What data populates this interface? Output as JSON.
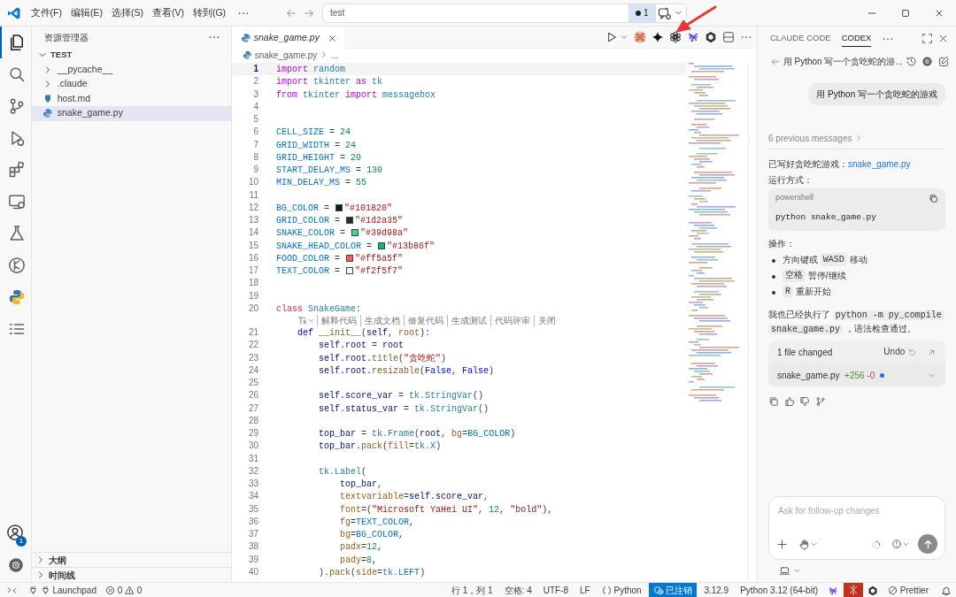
{
  "title_bar": {
    "menus": [
      "文件(F)",
      "编辑(E)",
      "选择(S)",
      "查看(V)",
      "转到(G)"
    ],
    "search": {
      "value": "test"
    },
    "changes_count": "1"
  },
  "activity_bar": {
    "items": [
      {
        "selected": true
      },
      {
        "selected": false
      },
      {
        "selected": false
      },
      {
        "selected": false
      },
      {
        "selected": false
      },
      {
        "selected": false
      },
      {
        "selected": false
      },
      {
        "selected": false
      },
      {
        "selected": false
      },
      {
        "selected": false
      }
    ],
    "account_badge": "1"
  },
  "explorer": {
    "title": "资源管理器",
    "root": {
      "label": "TEST",
      "expanded": true,
      "children": [
        {
          "label": "__pycache__",
          "kind": "folder",
          "expanded": false,
          "selected": false
        },
        {
          "label": ".claude",
          "kind": "folder",
          "expanded": false,
          "selected": false
        },
        {
          "label": "host.md",
          "kind": "markdown",
          "selected": false
        },
        {
          "label": "snake_game.py",
          "kind": "python",
          "selected": true
        }
      ]
    },
    "sections": [
      {
        "label": "大纲",
        "expanded": false
      },
      {
        "label": "时间线",
        "expanded": false
      }
    ]
  },
  "editor": {
    "tabs": [
      {
        "label": "snake_game.py",
        "selected": true,
        "preview": true
      }
    ],
    "breadcrumb": [
      "snake_game.py",
      "..."
    ],
    "lines": [
      {
        "number": "1",
        "current": true,
        "tokens": [
          {
            "text": "import",
            "kind": "keyword"
          },
          {
            "text": " random",
            "kind": "module"
          }
        ]
      },
      {
        "number": "2",
        "current": false,
        "tokens": [
          {
            "text": "import",
            "kind": "keyword"
          },
          {
            "text": " tkinter ",
            "kind": "module"
          },
          {
            "text": "as",
            "kind": "keyword"
          },
          {
            "text": " tk",
            "kind": "module"
          }
        ]
      },
      {
        "number": "3",
        "current": false,
        "tokens": [
          {
            "text": "from",
            "kind": "keyword"
          },
          {
            "text": " tkinter ",
            "kind": "module"
          },
          {
            "text": "import",
            "kind": "keyword"
          },
          {
            "text": " messagebox",
            "kind": "module"
          }
        ]
      },
      {
        "number": "4",
        "current": false
      },
      {
        "number": "5",
        "current": false
      },
      {
        "number": "6",
        "current": false,
        "tokens": [
          {
            "text": "CELL_SIZE",
            "kind": "constant"
          },
          {
            "text": " = ",
            "kind": "punct"
          },
          {
            "text": "24",
            "kind": "number"
          }
        ]
      },
      {
        "number": "7",
        "current": false,
        "tokens": [
          {
            "text": "GRID_WIDTH",
            "kind": "constant"
          },
          {
            "text": " = ",
            "kind": "punct"
          },
          {
            "text": "24",
            "kind": "number"
          }
        ]
      },
      {
        "number": "8",
        "current": false,
        "tokens": [
          {
            "text": "GRID_HEIGHT",
            "kind": "constant"
          },
          {
            "text": " = ",
            "kind": "punct"
          },
          {
            "text": "20",
            "kind": "number"
          }
        ]
      },
      {
        "number": "9",
        "current": false,
        "tokens": [
          {
            "text": "START_DELAY_MS",
            "kind": "constant"
          },
          {
            "text": " = ",
            "kind": "punct"
          },
          {
            "text": "130",
            "kind": "number"
          }
        ]
      },
      {
        "number": "10",
        "current": false,
        "tokens": [
          {
            "text": "MIN_DELAY_MS",
            "kind": "constant"
          },
          {
            "text": " = ",
            "kind": "punct"
          },
          {
            "text": "55",
            "kind": "number"
          }
        ]
      },
      {
        "number": "11",
        "current": false
      },
      {
        "number": "12",
        "current": false,
        "tokens": [
          {
            "text": "BG_COLOR",
            "kind": "constant"
          },
          {
            "text": " = ",
            "kind": "punct"
          },
          {
            "kind": "swatch",
            "color": "#101820"
          },
          {
            "text": "\"#101820\"",
            "kind": "string"
          }
        ]
      },
      {
        "number": "13",
        "current": false,
        "tokens": [
          {
            "text": "GRID_COLOR",
            "kind": "constant"
          },
          {
            "text": " = ",
            "kind": "punct"
          },
          {
            "kind": "swatch",
            "color": "#1d2a35"
          },
          {
            "text": "\"#1d2a35\"",
            "kind": "string"
          }
        ]
      },
      {
        "number": "14",
        "current": false,
        "tokens": [
          {
            "text": "SNAKE_COLOR",
            "kind": "constant"
          },
          {
            "text": " = ",
            "kind": "punct"
          },
          {
            "kind": "swatch",
            "color": "#39d98a"
          },
          {
            "text": "\"#39d98a\"",
            "kind": "string"
          }
        ]
      },
      {
        "number": "15",
        "current": false,
        "tokens": [
          {
            "text": "SNAKE_HEAD_COLOR",
            "kind": "constant"
          },
          {
            "text": " = ",
            "kind": "punct"
          },
          {
            "kind": "swatch",
            "color": "#13b86f"
          },
          {
            "text": "\"#13b86f\"",
            "kind": "string"
          }
        ]
      },
      {
        "number": "16",
        "current": false,
        "tokens": [
          {
            "text": "FOOD_COLOR",
            "kind": "constant"
          },
          {
            "text": " = ",
            "kind": "punct"
          },
          {
            "kind": "swatch",
            "color": "#ff5a5f"
          },
          {
            "text": "\"#ff5a5f\"",
            "kind": "string"
          }
        ]
      },
      {
        "number": "17",
        "current": false,
        "tokens": [
          {
            "text": "TEXT_COLOR",
            "kind": "constant"
          },
          {
            "text": " = ",
            "kind": "punct"
          },
          {
            "kind": "swatch",
            "color": "#f2f5f7"
          },
          {
            "text": "\"#f2f5f7\"",
            "kind": "string"
          }
        ]
      },
      {
        "number": "18",
        "current": false
      },
      {
        "number": "19",
        "current": false
      },
      {
        "number": "20",
        "current": false,
        "tokens": [
          {
            "text": "class",
            "kind": "class"
          },
          {
            "text": " SnakeGame",
            "kind": "module"
          },
          {
            "text": ":",
            "kind": "punct"
          }
        ],
        "codelens": {
          "items": [
            "解释代码",
            "生成文档",
            "修复代码",
            "生成测试",
            "代码评审",
            "关闭"
          ]
        }
      },
      {
        "number": "21",
        "current": false,
        "tokens": [
          {
            "text": "    def",
            "kind": "def"
          },
          {
            "text": " __init__",
            "kind": "function"
          },
          {
            "text": "(",
            "kind": "punct"
          },
          {
            "text": "self",
            "kind": "variable"
          },
          {
            "text": ", ",
            "kind": "punct"
          },
          {
            "text": "root",
            "kind": "param"
          },
          {
            "text": "):",
            "kind": "punct"
          }
        ]
      },
      {
        "number": "22",
        "current": false,
        "tokens": [
          {
            "text": "        self.root",
            "kind": "variable"
          },
          {
            "text": " = ",
            "kind": "punct"
          },
          {
            "text": "root",
            "kind": "variable"
          }
        ]
      },
      {
        "number": "23",
        "current": false,
        "tokens": [
          {
            "text": "        self.root.",
            "kind": "variable"
          },
          {
            "text": "title",
            "kind": "function"
          },
          {
            "text": "(",
            "kind": "punct"
          },
          {
            "text": "\"贪吃蛇\"",
            "kind": "string"
          },
          {
            "text": ")",
            "kind": "punct"
          }
        ]
      },
      {
        "number": "24",
        "current": false,
        "tokens": [
          {
            "text": "        self.root.",
            "kind": "variable"
          },
          {
            "text": "resizable",
            "kind": "function"
          },
          {
            "text": "(",
            "kind": "punct"
          },
          {
            "text": "False",
            "kind": "bool"
          },
          {
            "text": ", ",
            "kind": "punct"
          },
          {
            "text": "False",
            "kind": "bool"
          },
          {
            "text": ")",
            "kind": "punct"
          }
        ]
      },
      {
        "number": "25",
        "current": false
      },
      {
        "number": "26",
        "current": false,
        "tokens": [
          {
            "text": "        self.score_var",
            "kind": "variable"
          },
          {
            "text": " = ",
            "kind": "punct"
          },
          {
            "text": "tk.StringVar",
            "kind": "module"
          },
          {
            "text": "()",
            "kind": "punct"
          }
        ]
      },
      {
        "number": "27",
        "current": false,
        "tokens": [
          {
            "text": "        self.status_var",
            "kind": "variable"
          },
          {
            "text": " = ",
            "kind": "punct"
          },
          {
            "text": "tk.StringVar",
            "kind": "module"
          },
          {
            "text": "()",
            "kind": "punct"
          }
        ]
      },
      {
        "number": "28",
        "current": false
      },
      {
        "number": "29",
        "current": false,
        "tokens": [
          {
            "text": "        top_bar",
            "kind": "variable"
          },
          {
            "text": " = ",
            "kind": "punct"
          },
          {
            "text": "tk.Frame",
            "kind": "module"
          },
          {
            "text": "(",
            "kind": "punct"
          },
          {
            "text": "root",
            "kind": "variable"
          },
          {
            "text": ", ",
            "kind": "punct"
          },
          {
            "text": "bg",
            "kind": "param"
          },
          {
            "text": "=",
            "kind": "punct"
          },
          {
            "text": "BG_COLOR",
            "kind": "constant"
          },
          {
            "text": ")",
            "kind": "punct"
          }
        ]
      },
      {
        "number": "30",
        "current": false,
        "tokens": [
          {
            "text": "        top_bar.",
            "kind": "variable"
          },
          {
            "text": "pack",
            "kind": "function"
          },
          {
            "text": "(",
            "kind": "punct"
          },
          {
            "text": "fill",
            "kind": "param"
          },
          {
            "text": "=",
            "kind": "punct"
          },
          {
            "text": "tk.",
            "kind": "module"
          },
          {
            "text": "X",
            "kind": "constant"
          },
          {
            "text": ")",
            "kind": "punct"
          }
        ]
      },
      {
        "number": "31",
        "current": false
      },
      {
        "number": "32",
        "current": false,
        "tokens": [
          {
            "text": "        tk.Label",
            "kind": "module"
          },
          {
            "text": "(",
            "kind": "punct"
          }
        ]
      },
      {
        "number": "33",
        "current": false,
        "tokens": [
          {
            "text": "            top_bar",
            "kind": "variable"
          },
          {
            "text": ",",
            "kind": "punct"
          }
        ]
      },
      {
        "number": "34",
        "current": false,
        "tokens": [
          {
            "text": "            textvariable",
            "kind": "param"
          },
          {
            "text": "=",
            "kind": "punct"
          },
          {
            "text": "self.score_var",
            "kind": "variable"
          },
          {
            "text": ",",
            "kind": "punct"
          }
        ]
      },
      {
        "number": "35",
        "current": false,
        "tokens": [
          {
            "text": "            font",
            "kind": "param"
          },
          {
            "text": "=(",
            "kind": "punct"
          },
          {
            "text": "\"Microsoft YaHei UI\"",
            "kind": "string"
          },
          {
            "text": ", ",
            "kind": "punct"
          },
          {
            "text": "12",
            "kind": "number"
          },
          {
            "text": ", ",
            "kind": "punct"
          },
          {
            "text": "\"bold\"",
            "kind": "string"
          },
          {
            "text": "),",
            "kind": "punct"
          }
        ]
      },
      {
        "number": "36",
        "current": false,
        "tokens": [
          {
            "text": "            fg",
            "kind": "param"
          },
          {
            "text": "=",
            "kind": "punct"
          },
          {
            "text": "TEXT_COLOR",
            "kind": "constant"
          },
          {
            "text": ",",
            "kind": "punct"
          }
        ]
      },
      {
        "number": "37",
        "current": false,
        "tokens": [
          {
            "text": "            bg",
            "kind": "param"
          },
          {
            "text": "=",
            "kind": "punct"
          },
          {
            "text": "BG_COLOR",
            "kind": "constant"
          },
          {
            "text": ",",
            "kind": "punct"
          }
        ]
      },
      {
        "number": "38",
        "current": false,
        "tokens": [
          {
            "text": "            padx",
            "kind": "param"
          },
          {
            "text": "=",
            "kind": "punct"
          },
          {
            "text": "12",
            "kind": "number"
          },
          {
            "text": ",",
            "kind": "punct"
          }
        ]
      },
      {
        "number": "39",
        "current": false,
        "tokens": [
          {
            "text": "            pady",
            "kind": "param"
          },
          {
            "text": "=",
            "kind": "punct"
          },
          {
            "text": "8",
            "kind": "number"
          },
          {
            "text": ",",
            "kind": "punct"
          }
        ]
      },
      {
        "number": "40",
        "current": false,
        "tokens": [
          {
            "text": "        ).",
            "kind": "punct"
          },
          {
            "text": "pack",
            "kind": "function"
          },
          {
            "text": "(",
            "kind": "punct"
          },
          {
            "text": "side",
            "kind": "param"
          },
          {
            "text": "=",
            "kind": "punct"
          },
          {
            "text": "tk.",
            "kind": "module"
          },
          {
            "text": "LEFT",
            "kind": "constant"
          },
          {
            "text": ")",
            "kind": "punct"
          }
        ]
      }
    ]
  },
  "chat_panel": {
    "tabs": [
      {
        "label": "CLAUDE CODE",
        "selected": false
      },
      {
        "label": "CODEX",
        "selected": true
      }
    ],
    "thread_title": "用 Python 写一个贪吃蛇的游...",
    "user_message": "用 Python 写一个贪吃蛇的游戏",
    "previous_messages": "6 previous messages",
    "reply": {
      "intro": "已写好贪吃蛇游戏：",
      "intro_link": "snake_game.py",
      "run_label": "运行方式：",
      "code_block": {
        "language": "powershell",
        "code": "python snake_game.py"
      },
      "controls_label": "操作：",
      "bullets": [
        [
          {
            "kind": "text",
            "text": "方向键或"
          },
          {
            "kind": "code",
            "text": "WASD"
          },
          {
            "kind": "text",
            "text": "移动"
          }
        ],
        [
          {
            "kind": "code",
            "text": "空格"
          },
          {
            "kind": "text",
            "text": "暂停/继续"
          }
        ],
        [
          {
            "kind": "code",
            "text": "R"
          },
          {
            "kind": "text",
            "text": "重新开始"
          }
        ]
      ],
      "closing": [
        {
          "kind": "text",
          "text": "我也已经执行了"
        },
        {
          "kind": "code",
          "text": "python -m py_compile"
        },
        {
          "kind": "code",
          "text": "snake_game.py"
        },
        {
          "kind": "text",
          "text": "，语法检查通过。"
        }
      ]
    },
    "changes": {
      "summary": "1 file changed",
      "undo": "Undo",
      "files": [
        {
          "name": "snake_game.py",
          "added": "+256",
          "removed": "-0",
          "pending": true
        }
      ]
    },
    "composer": {
      "placeholder": "Ask for follow-up changes"
    }
  },
  "status_bar": {
    "launchpad": "Launchpad",
    "errors": "0",
    "warnings": "0",
    "position": "行 1，列 1",
    "indent": "空格: 4",
    "encoding": "UTF-8",
    "eol": "LF",
    "language": "Python",
    "account": "已注销",
    "python_version": "3.12.9",
    "interpreter": "Python 3.12 (64-bit)",
    "formatter": "Prettier"
  }
}
